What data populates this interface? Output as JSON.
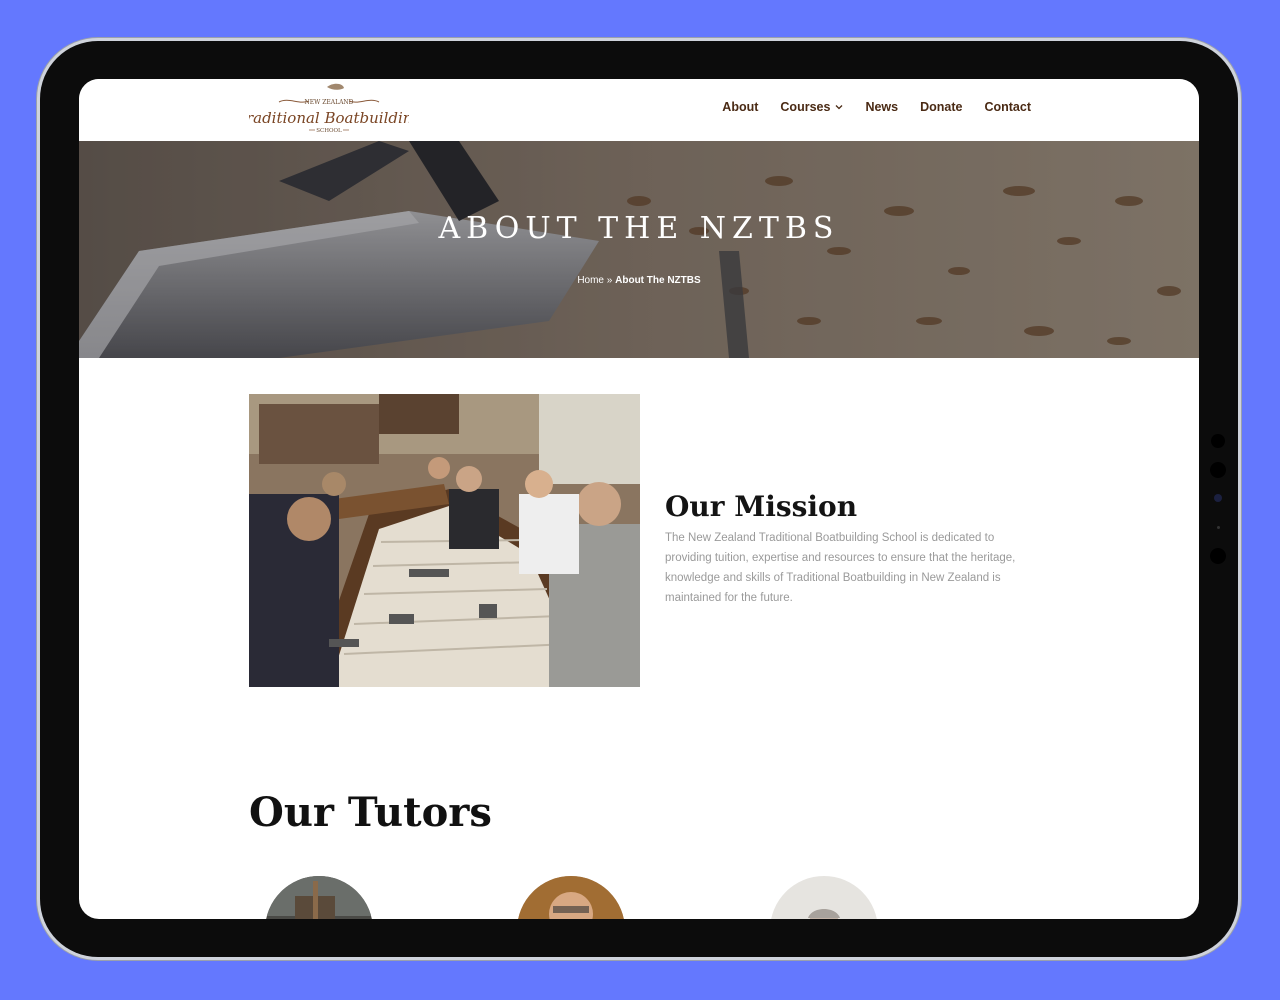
{
  "brand": {
    "logo_top": "NEW ZEALAND",
    "logo_main": "Traditional Boatbuilding",
    "logo_bottom": "SCHOOL"
  },
  "nav": {
    "items": [
      {
        "label": "About"
      },
      {
        "label": "Courses"
      },
      {
        "label": "News"
      },
      {
        "label": "Donate"
      },
      {
        "label": "Contact"
      }
    ]
  },
  "hero": {
    "title": "About The NZTBS",
    "breadcrumb": {
      "home": "Home",
      "separator": "»",
      "current": "About The NZTBS"
    }
  },
  "mission": {
    "title": "Our Mission",
    "text": "The New Zealand Traditional Boatbuilding School is dedicated to providing tuition, expertise and resources to ensure that the heritage, knowledge and skills of Traditional Boatbuilding in New Zealand is maintained for the future."
  },
  "tutors": {
    "title": "Our Tutors"
  },
  "colors": {
    "background": "#6478fe",
    "nav_text": "#4a2a14",
    "body_text": "#9a9a9a",
    "heading": "#141414"
  }
}
